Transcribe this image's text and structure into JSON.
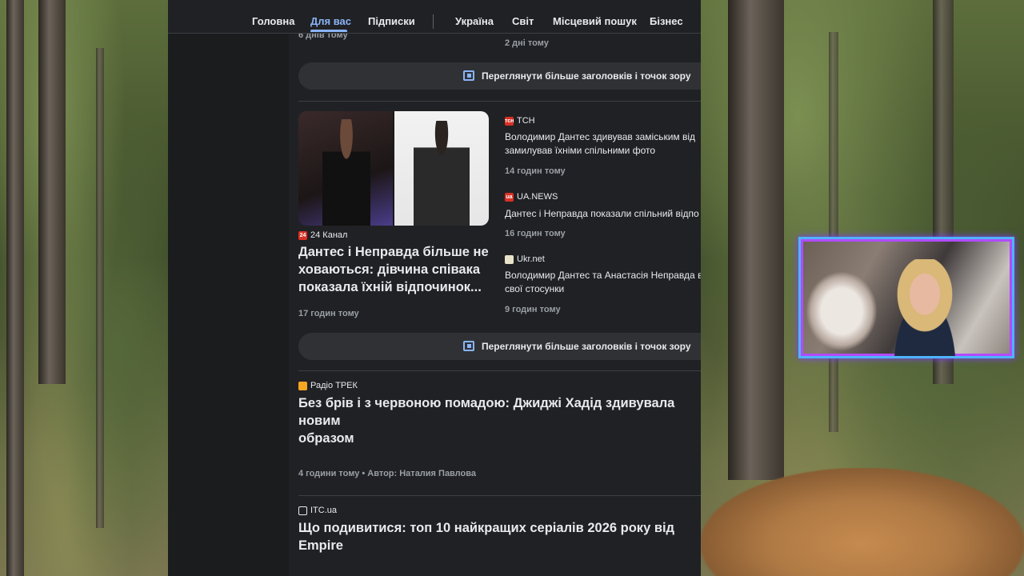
{
  "nav": {
    "items": [
      "Головна",
      "Для вас",
      "Підписки",
      "Україна",
      "Світ",
      "Місцевий пошук",
      "Бізнес"
    ],
    "active": "Для вас"
  },
  "feed": {
    "top_left_time": "6 днів тому",
    "top_right_time": "2 дні тому",
    "more_headlines_label": "Переглянути більше заголовків і точок зору",
    "story2": {
      "main": {
        "source": "24 Канал",
        "source_icon": "24",
        "title_line1": "Дантес і Неправда більше не",
        "title_line2": "ховаються: дівчина співака",
        "title_line3": "показала їхній відпочинок...",
        "time": "17 годин тому"
      },
      "related": [
        {
          "source": "ТСН",
          "source_icon": "тсн",
          "color": "#d93025",
          "title": "Володимир Дантес здивував заміським від\nзамилував їхніми спільними фото",
          "time": "14 годин тому"
        },
        {
          "source": "UA.NEWS",
          "source_icon": "ua",
          "color": "#d93025",
          "title": "Дантес і Неправда показали спільний відпо",
          "time": "16 годин тому"
        },
        {
          "source": "Ukr.net",
          "source_icon": "",
          "color": "#e8e2c8",
          "title": "Володимир Дантес та Анастасія Неправда в\nсвої стосунки",
          "time": "9 годин тому"
        }
      ]
    },
    "story3": {
      "source": "Радіо ТРЕК",
      "title_line1": "Без брів і з червоною помадою: Джиджі Хадід здивувала новим",
      "title_line2": "образом",
      "meta": "4 години тому • Автор: Наталия Павлова"
    },
    "story4": {
      "source": "ITC.ua",
      "title_line1": "Що подивитися: топ 10 найкращих серіалів 2026 року від",
      "title_line2": "Empire"
    }
  }
}
